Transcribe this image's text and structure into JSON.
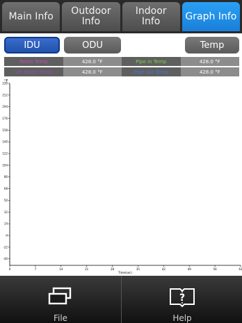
{
  "tabs": [
    {
      "label": "Main Info",
      "active": false
    },
    {
      "label": "Outdoor\nInfo",
      "active": false
    },
    {
      "label": "Indoor\nInfo",
      "active": false
    },
    {
      "label": "Graph Info",
      "active": true
    }
  ],
  "subbar": {
    "idu": "IDU",
    "odu": "ODU",
    "temp": "Temp"
  },
  "legend": {
    "row1": [
      {
        "label": "Room Temp",
        "color": "#b84fb3"
      },
      {
        "label": "428.0 °F",
        "color": "#ffffff"
      },
      {
        "label": "Pipe in Temp",
        "color": "#7bd14a"
      },
      {
        "label": "428.0 °F",
        "color": "#ffffff"
      }
    ],
    "row2": [
      {
        "label": "Set Room Temp",
        "color": "#8d4fb0"
      },
      {
        "label": "428.0 °F",
        "color": "#ffffff"
      },
      {
        "label": "Pipe out Temp",
        "color": "#3e78d6"
      },
      {
        "label": "428.0 °F",
        "color": "#ffffff"
      }
    ]
  },
  "chart_data": {
    "type": "line",
    "ylabel": "°F",
    "xlabel": "Time(sec)",
    "ylim": [
      -50,
      230
    ],
    "xlim": [
      0,
      63
    ],
    "yticks": [
      230,
      212,
      194,
      176,
      158,
      140,
      122,
      104,
      86,
      68,
      50,
      32,
      14,
      -4,
      -22,
      -40
    ],
    "xticks": [
      0,
      7,
      14,
      21,
      28,
      35,
      42,
      49,
      56,
      63
    ],
    "grid": false,
    "series": []
  },
  "bottom": {
    "file": "File",
    "help": "Help"
  }
}
